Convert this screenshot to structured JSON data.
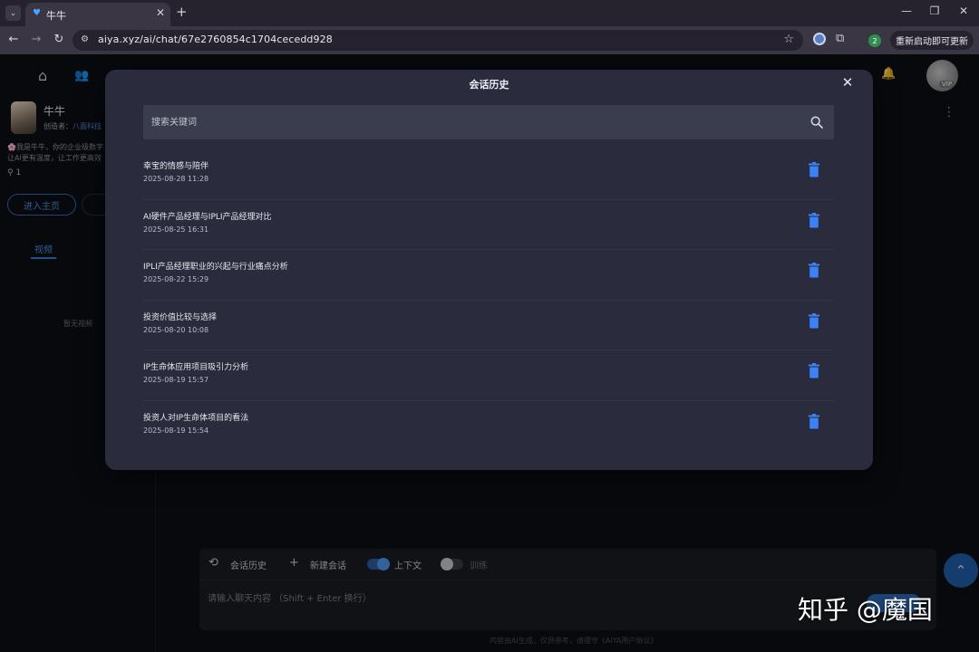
{
  "browser": {
    "tab_title": "牛牛",
    "url": "aiya.xyz/ai/chat/67e2760854c1704cecedd928",
    "profile_badge": "2",
    "update_button": "重新启动即可更新"
  },
  "icons": {
    "tab_menu": "chevron-down-icon",
    "favicon": "heart-icon",
    "tab_close": "close-icon",
    "new_tab": "plus-icon",
    "back": "arrow-left-icon",
    "forward": "arrow-right-icon",
    "reload": "reload-icon",
    "bookmark": "star-icon",
    "extensions": "puzzle-icon",
    "home": "home-icon",
    "people": "people-icon",
    "bell": "bell-icon",
    "search": "search-icon",
    "delete": "trash-icon",
    "history": "history-icon",
    "new_chat": "plus-icon",
    "scroll_top": "chevron-up-icon"
  },
  "sidebar": {
    "agent_name": "牛牛",
    "creator_label": "创造者：",
    "creator_name": "八面科技",
    "description_line1": "🌸我是牛牛，你的企业级数字",
    "description_line2": "让AI更有温度，让工作更高效",
    "user_count": "1",
    "home_button": "进入主页",
    "video_tab": "视频",
    "no_video": "暂无视频"
  },
  "header": {
    "vip_badge": "VIP"
  },
  "modal": {
    "title": "会话历史",
    "search_placeholder": "搜索关键词",
    "items": [
      {
        "title": "幸宝的情感与陪伴",
        "time": "2025-08-28 11:28"
      },
      {
        "title": "AI硬件产品经理与IPLI产品经理对比",
        "time": "2025-08-25 16:31"
      },
      {
        "title": "IPLI产品经理职业的兴起与行业痛点分析",
        "time": "2025-08-22 15:29"
      },
      {
        "title": "投资价值比较与选择",
        "time": "2025-08-20 10:08"
      },
      {
        "title": "IP生命体应用项目吸引力分析",
        "time": "2025-08-19 15:57"
      },
      {
        "title": "投资人对IP生命体项目的看法",
        "time": "2025-08-19 15:54"
      }
    ]
  },
  "chat": {
    "history_button": "会话历史",
    "new_chat_button": "新建会话",
    "context_toggle_label": "上下文",
    "context_toggle_on": true,
    "training_toggle_label": "训练",
    "training_toggle_on": false,
    "input_placeholder": "请输入聊天内容 （Shift + Enter 换行）",
    "footer_note": "内容由AI生成，仅供参考，请遵守《AIYA用户协议》"
  },
  "colors": {
    "accent": "#3b82f6",
    "modal_bg": "#2a2c3d",
    "page_bg": "#0c0e14"
  },
  "watermark": "知乎 @魔国"
}
